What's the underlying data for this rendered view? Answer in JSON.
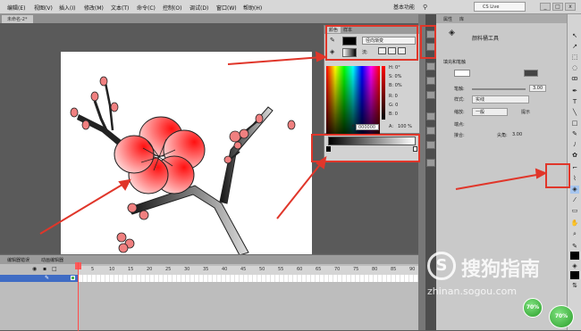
{
  "menu": [
    "编辑(E)",
    "视图(V)",
    "插入(I)",
    "修改(M)",
    "文本(T)",
    "命令(C)",
    "控制(O)",
    "调试(D)",
    "窗口(W)",
    "帮助(H)"
  ],
  "workspace_label": "基本功能",
  "search_label": "CS Live",
  "doc_tab": "未命名-2*",
  "timeline": {
    "tabs": [
      "编辑器错误",
      "动画编辑器"
    ],
    "ruler": [
      "5",
      "10",
      "15",
      "20",
      "25",
      "30",
      "35",
      "40",
      "45",
      "50",
      "55",
      "60",
      "65",
      "70",
      "75",
      "80",
      "85",
      "90"
    ]
  },
  "color_panel": {
    "tabs": [
      "颜色",
      "样本"
    ],
    "fill_type": "径向渐变",
    "flow_label": "流:",
    "h": "H: 0°",
    "s": "S: 0%",
    "b": "B: 0%",
    "r": "R: 0",
    "g": "G: 0",
    "b2": "B: 0",
    "alpha_label": "A:",
    "alpha_value": "100 %",
    "hex_hash": "#",
    "hex": "000000"
  },
  "properties": {
    "tabs": [
      "属性",
      "库"
    ],
    "tool_name": "颜料桶工具",
    "section": "填充和笔触",
    "stroke_value": "3.00",
    "stroke_label": "笔触:",
    "style_label": "样式:",
    "style_value": "实线",
    "scale_label": "缩放:",
    "scale_value": "一般",
    "hint_label": "提示",
    "cap_label": "端点:",
    "join_label": "接合:",
    "miter_label": "尖角:",
    "miter_value": "3.00"
  },
  "watermark": {
    "logo": "S",
    "cn": "搜狗指南",
    "url": "zhinan.sogou.com"
  },
  "badges": [
    "70%",
    "70%"
  ]
}
